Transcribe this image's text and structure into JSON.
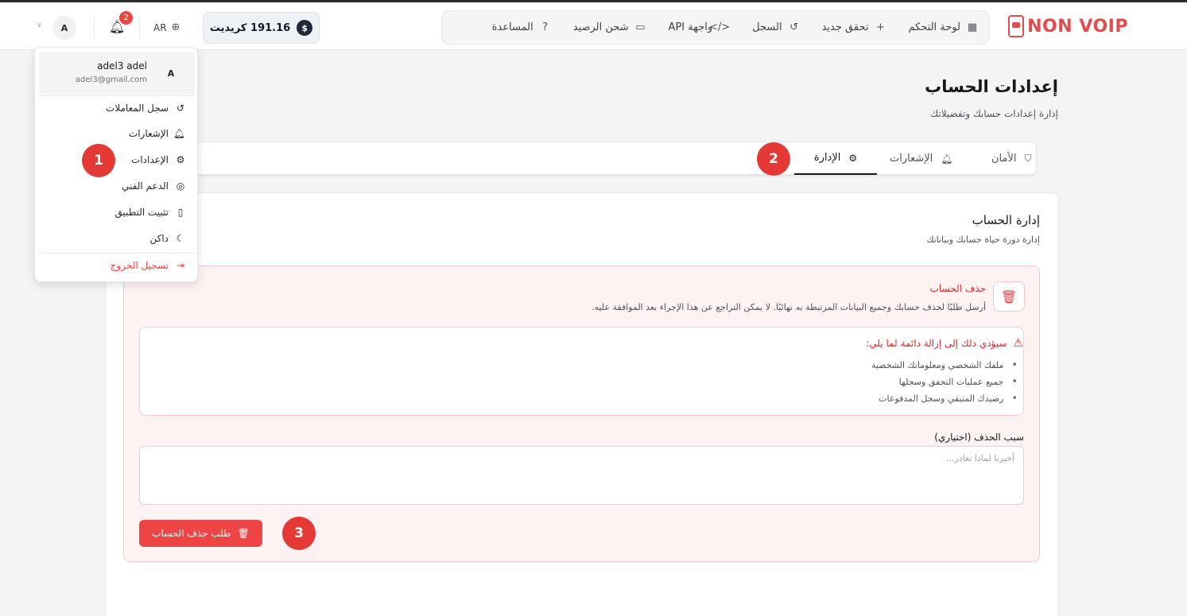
{
  "brand": {
    "logo_non": "NON",
    "logo_voip": "VOIP",
    "accent": "#e24c4c"
  },
  "nav": {
    "items": [
      {
        "label": "لوحة التحكم",
        "icon": "grid-icon"
      },
      {
        "label": "تحقق جديد",
        "icon": "plus-icon"
      },
      {
        "label": "السجل",
        "icon": "history-icon"
      },
      {
        "label": "واجهة API",
        "icon": "code-icon"
      },
      {
        "label": "شحن الرصيد",
        "icon": "wallet-icon"
      },
      {
        "label": "المساعدة",
        "icon": "help-circle-icon"
      }
    ]
  },
  "header": {
    "credit_label": "191.16 كريديت",
    "credit_symbol": "$",
    "language": "AR",
    "notification_count": "2",
    "avatar_letter": "A"
  },
  "user_menu": {
    "name": "adel3 adel",
    "email": "adel3@gmail.com",
    "avatar_letter": "A",
    "items": [
      {
        "label": "سجل المعاملات",
        "icon": "history-icon"
      },
      {
        "label": "الإشعارات",
        "icon": "bell-icon"
      },
      {
        "label": "الإعدادات",
        "icon": "gear-icon"
      },
      {
        "label": "الدعم الفني",
        "icon": "lifebuoy-icon"
      },
      {
        "label": "تثبيت التطبيق",
        "icon": "smartphone-icon"
      },
      {
        "label": "داكن",
        "icon": "moon-icon"
      }
    ],
    "logout": "تسجيل الخروج"
  },
  "page": {
    "title": "إعدادات الحساب",
    "subtitle": "إدارة إعدادات حسابك وتفضيلاتك"
  },
  "tabs": [
    {
      "label": "الأمان",
      "icon": "shield-icon"
    },
    {
      "label": "الإشعارات",
      "icon": "bell-icon"
    },
    {
      "label": "الإدارة",
      "icon": "gear-icon",
      "active": true
    }
  ],
  "management": {
    "title": "إدارة الحساب",
    "subtitle": "إدارة دورة حياة حسابك وبياناتك",
    "delete": {
      "title": "حذف الحساب",
      "description": "أرسل طلبًا لحذف حسابك وجميع البيانات المرتبطة به نهائيًا. لا يمكن التراجع عن هذا الإجراء بعد الموافقة عليه.",
      "warning_title": "سيؤدي ذلك إلى إزالة دائمة لما يلي:",
      "warning_items": [
        "ملفك الشخصي ومعلوماتك الشخصية",
        "جميع عمليات التحقق وسجلها",
        "رصيدك المتبقي وسجل المدفوعات"
      ],
      "reason_label": "سبب الحذف (اختياري)",
      "reason_placeholder": "أخبرنا لماذا تغادر...",
      "reason_value": "",
      "button_label": "طلب حذف الحساب"
    }
  },
  "markers": [
    "1",
    "2",
    "3"
  ]
}
